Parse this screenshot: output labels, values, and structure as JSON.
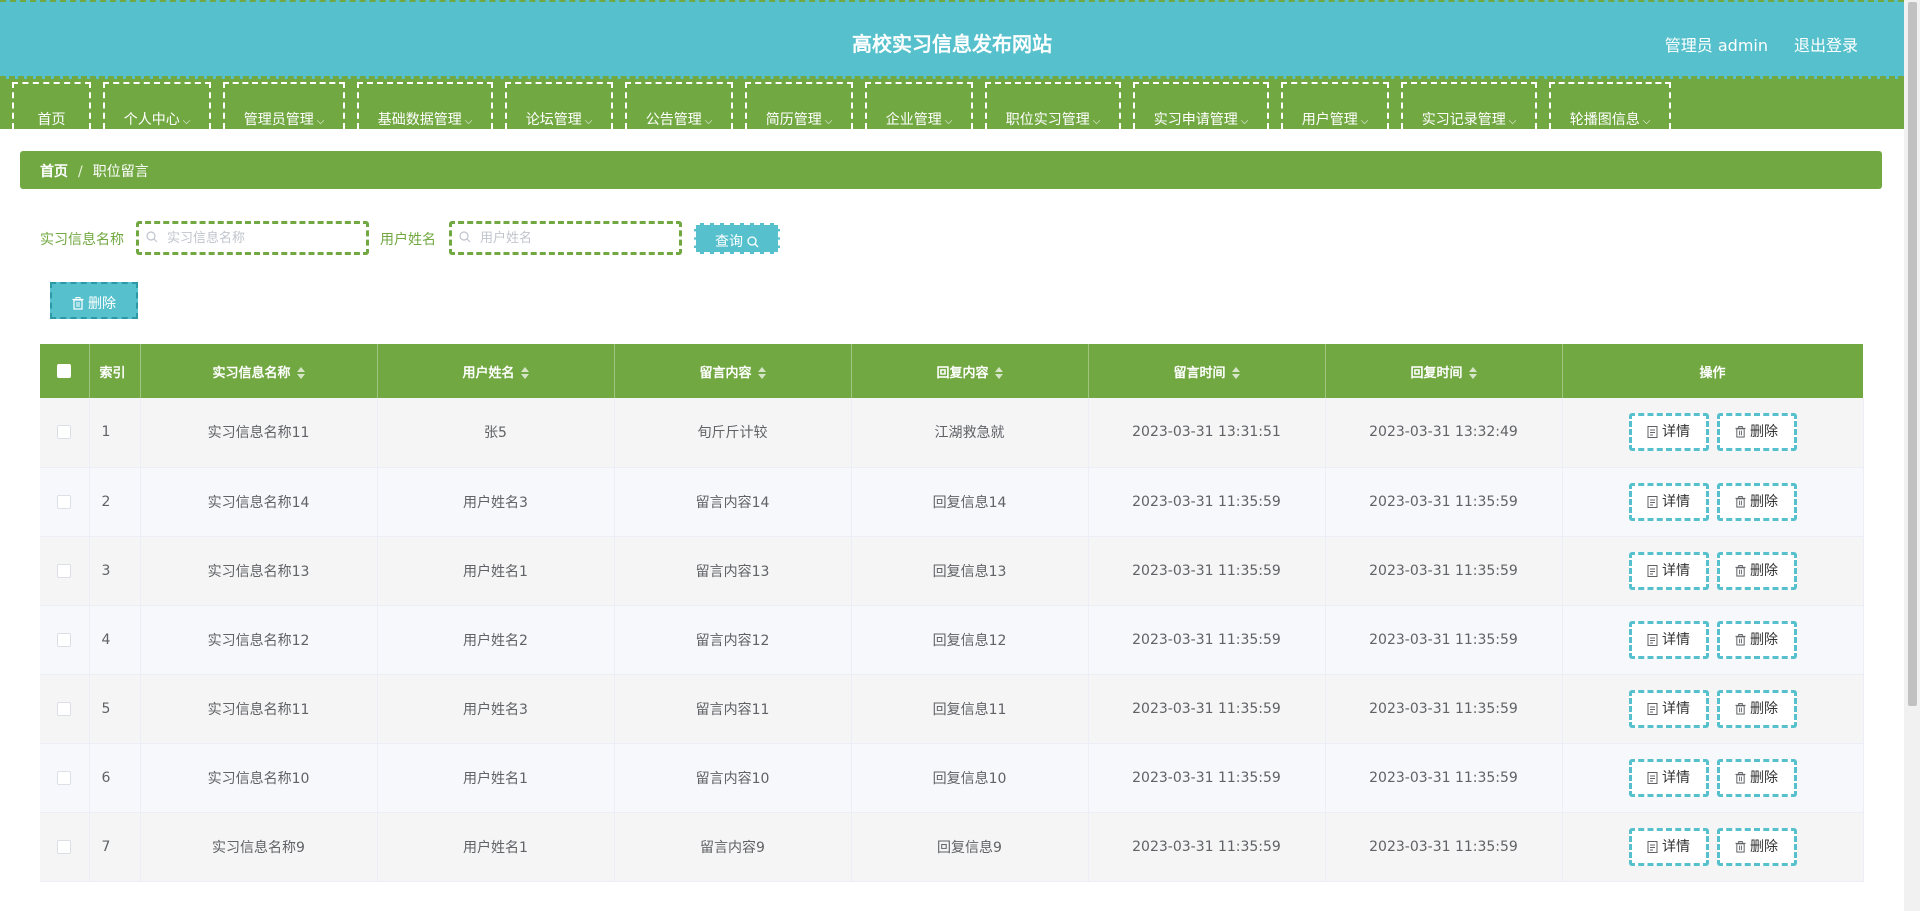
{
  "header": {
    "title": "高校实习信息发布网站",
    "user": "管理员 admin",
    "logout": "退出登录"
  },
  "nav": [
    {
      "label": "首页",
      "dropdown": false
    },
    {
      "label": "个人中心",
      "dropdown": true
    },
    {
      "label": "管理员管理",
      "dropdown": true
    },
    {
      "label": "基础数据管理",
      "dropdown": true
    },
    {
      "label": "论坛管理",
      "dropdown": true
    },
    {
      "label": "公告管理",
      "dropdown": true
    },
    {
      "label": "简历管理",
      "dropdown": true
    },
    {
      "label": "企业管理",
      "dropdown": true
    },
    {
      "label": "职位实习管理",
      "dropdown": true
    },
    {
      "label": "实习申请管理",
      "dropdown": true
    },
    {
      "label": "用户管理",
      "dropdown": true
    },
    {
      "label": "实习记录管理",
      "dropdown": true
    },
    {
      "label": "轮播图信息",
      "dropdown": true
    }
  ],
  "breadcrumb": {
    "home": "首页",
    "separator": "/",
    "current": "职位留言"
  },
  "search": {
    "field1_label": "实习信息名称",
    "field1_placeholder": "实习信息名称",
    "field1_value": "",
    "field2_label": "用户姓名",
    "field2_placeholder": "用户姓名",
    "field2_value": "",
    "query_label": "查询"
  },
  "toolbar": {
    "delete_label": "删除"
  },
  "table": {
    "columns": [
      "索引",
      "实习信息名称",
      "用户姓名",
      "留言内容",
      "回复内容",
      "留言时间",
      "回复时间",
      "操作"
    ],
    "detail_label": "详情",
    "delete_label": "删除",
    "rows": [
      {
        "index": "1",
        "name": "实习信息名称11",
        "user": "张5",
        "message": "旬斤斤计较",
        "reply": "江湖救急就",
        "msg_time": "2023-03-31 13:31:51",
        "reply_time": "2023-03-31 13:32:49"
      },
      {
        "index": "2",
        "name": "实习信息名称14",
        "user": "用户姓名3",
        "message": "留言内容14",
        "reply": "回复信息14",
        "msg_time": "2023-03-31 11:35:59",
        "reply_time": "2023-03-31 11:35:59"
      },
      {
        "index": "3",
        "name": "实习信息名称13",
        "user": "用户姓名1",
        "message": "留言内容13",
        "reply": "回复信息13",
        "msg_time": "2023-03-31 11:35:59",
        "reply_time": "2023-03-31 11:35:59"
      },
      {
        "index": "4",
        "name": "实习信息名称12",
        "user": "用户姓名2",
        "message": "留言内容12",
        "reply": "回复信息12",
        "msg_time": "2023-03-31 11:35:59",
        "reply_time": "2023-03-31 11:35:59"
      },
      {
        "index": "5",
        "name": "实习信息名称11",
        "user": "用户姓名3",
        "message": "留言内容11",
        "reply": "回复信息11",
        "msg_time": "2023-03-31 11:35:59",
        "reply_time": "2023-03-31 11:35:59"
      },
      {
        "index": "6",
        "name": "实习信息名称10",
        "user": "用户姓名1",
        "message": "留言内容10",
        "reply": "回复信息10",
        "msg_time": "2023-03-31 11:35:59",
        "reply_time": "2023-03-31 11:35:59"
      },
      {
        "index": "7",
        "name": "实习信息名称9",
        "user": "用户姓名1",
        "message": "留言内容9",
        "reply": "回复信息9",
        "msg_time": "2023-03-31 11:35:59",
        "reply_time": "2023-03-31 11:35:59"
      }
    ]
  },
  "colors": {
    "primary_green": "#72a842",
    "accent_teal": "#56c1cd"
  }
}
